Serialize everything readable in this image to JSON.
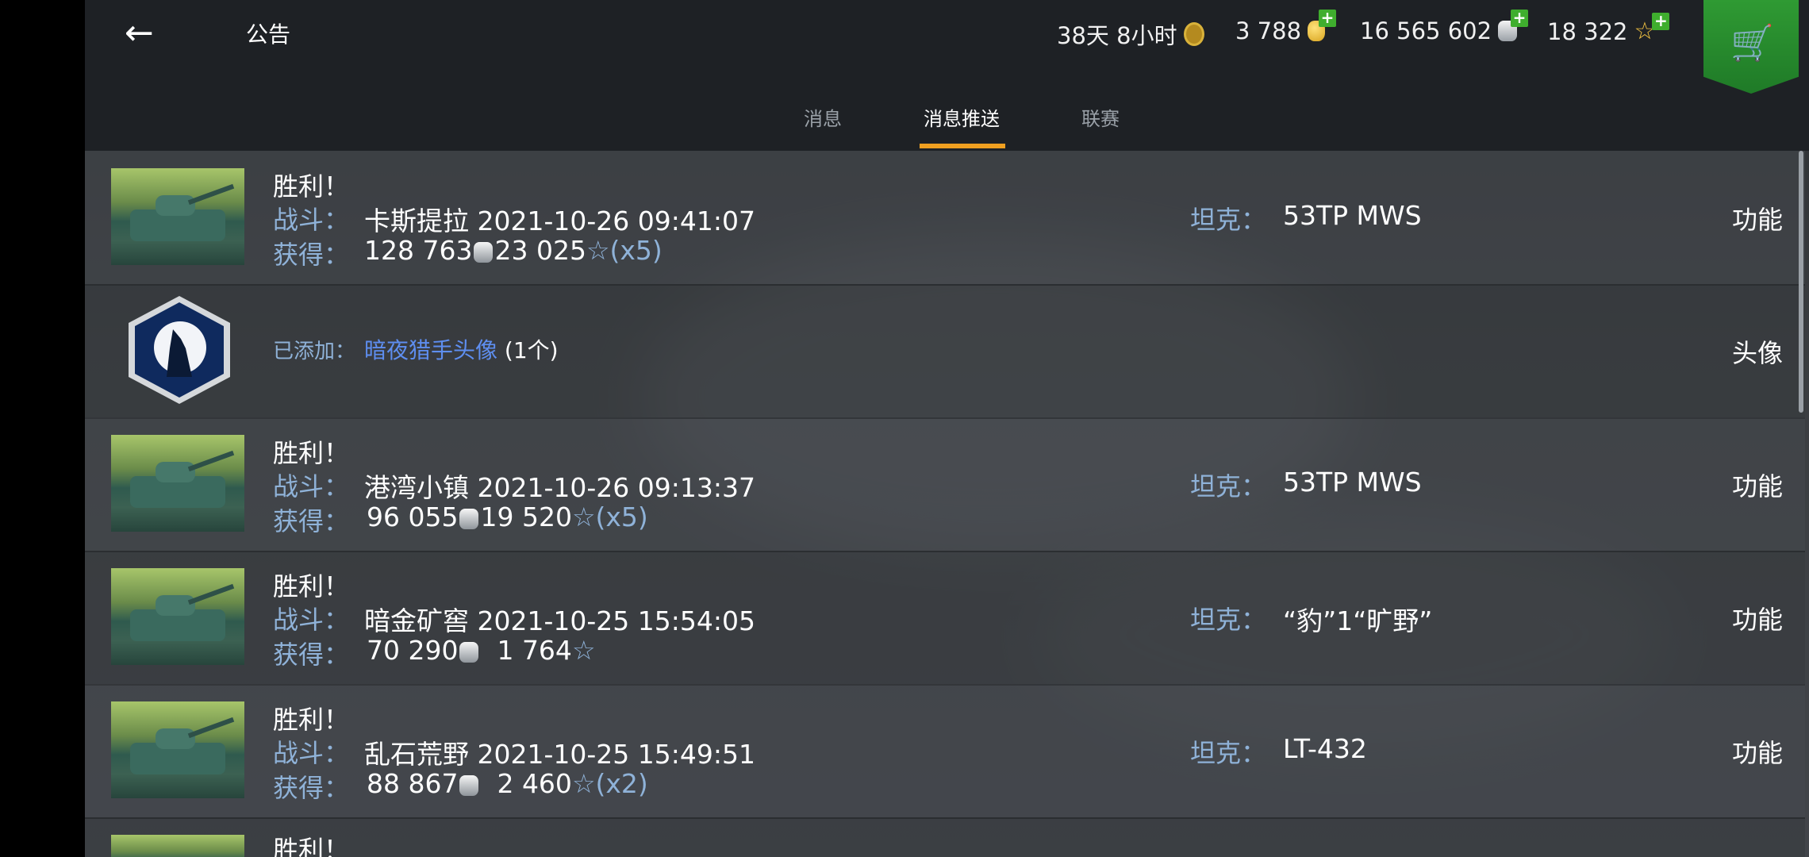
{
  "header": {
    "back_icon": "arrow-left-icon",
    "title": "公告",
    "premium_time": "38天 8小时",
    "gold": "3 788",
    "credits": "16 565 602",
    "free_xp": "18 322",
    "shop_icon": "cart-icon"
  },
  "tabs": [
    {
      "label": "消息",
      "active": false
    },
    {
      "label": "消息推送",
      "active": true
    },
    {
      "label": "联赛",
      "active": false
    }
  ],
  "messages": [
    {
      "kind": "battle",
      "title": "胜利！",
      "battle_label": "战斗：",
      "map_time": "卡斯提拉 2021-10-26 09:41:07",
      "reward_label": "获得：",
      "credits": "128 763",
      "xp": "23 025",
      "multiplier": "(x5)",
      "tank_label": "坦克：",
      "tank": "53TP MWS",
      "action": "功能"
    },
    {
      "kind": "avatar",
      "added_label": "已添加：",
      "item": "暗夜猎手头像",
      "count": "(1个)",
      "action": "头像"
    },
    {
      "kind": "battle",
      "title": "胜利！",
      "battle_label": "战斗：",
      "map_time": "港湾小镇 2021-10-26 09:13:37",
      "reward_label": "获得：",
      "credits": "96 055",
      "xp": "19 520",
      "multiplier": "(x5)",
      "tank_label": "坦克：",
      "tank": "53TP MWS",
      "action": "功能"
    },
    {
      "kind": "battle",
      "title": "胜利！",
      "battle_label": "战斗：",
      "map_time": "暗金矿窖 2021-10-25 15:54:05",
      "reward_label": "获得：",
      "credits": "70 290",
      "xp": "1 764",
      "multiplier": "",
      "tank_label": "坦克：",
      "tank": "“豹”1“旷野”",
      "action": "功能"
    },
    {
      "kind": "battle",
      "title": "胜利！",
      "battle_label": "战斗：",
      "map_time": "乱石荒野 2021-10-25 15:49:51",
      "reward_label": "获得：",
      "credits": "88 867",
      "xp": "2 460",
      "multiplier": "(x2)",
      "tank_label": "坦克：",
      "tank": "LT-432",
      "action": "功能"
    },
    {
      "kind": "battle",
      "title": "胜利！"
    }
  ]
}
